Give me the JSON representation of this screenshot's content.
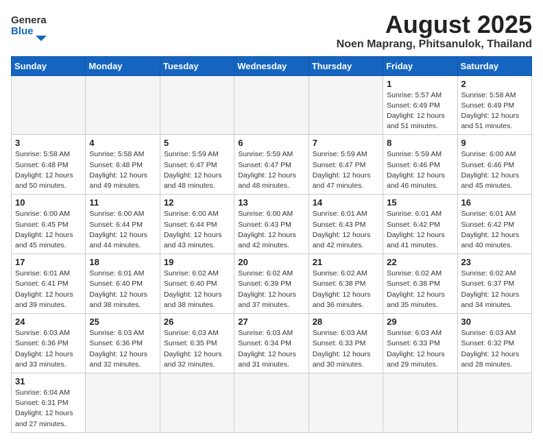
{
  "header": {
    "logo_general": "General",
    "logo_blue": "Blue",
    "month_title": "August 2025",
    "location": "Noen Maprang, Phitsanulok, Thailand"
  },
  "days_of_week": [
    "Sunday",
    "Monday",
    "Tuesday",
    "Wednesday",
    "Thursday",
    "Friday",
    "Saturday"
  ],
  "weeks": [
    [
      {
        "day": "",
        "info": ""
      },
      {
        "day": "",
        "info": ""
      },
      {
        "day": "",
        "info": ""
      },
      {
        "day": "",
        "info": ""
      },
      {
        "day": "",
        "info": ""
      },
      {
        "day": "1",
        "info": "Sunrise: 5:57 AM\nSunset: 6:49 PM\nDaylight: 12 hours\nand 51 minutes."
      },
      {
        "day": "2",
        "info": "Sunrise: 5:58 AM\nSunset: 6:49 PM\nDaylight: 12 hours\nand 51 minutes."
      }
    ],
    [
      {
        "day": "3",
        "info": "Sunrise: 5:58 AM\nSunset: 6:48 PM\nDaylight: 12 hours\nand 50 minutes."
      },
      {
        "day": "4",
        "info": "Sunrise: 5:58 AM\nSunset: 6:48 PM\nDaylight: 12 hours\nand 49 minutes."
      },
      {
        "day": "5",
        "info": "Sunrise: 5:59 AM\nSunset: 6:47 PM\nDaylight: 12 hours\nand 48 minutes."
      },
      {
        "day": "6",
        "info": "Sunrise: 5:59 AM\nSunset: 6:47 PM\nDaylight: 12 hours\nand 48 minutes."
      },
      {
        "day": "7",
        "info": "Sunrise: 5:59 AM\nSunset: 6:47 PM\nDaylight: 12 hours\nand 47 minutes."
      },
      {
        "day": "8",
        "info": "Sunrise: 5:59 AM\nSunset: 6:46 PM\nDaylight: 12 hours\nand 46 minutes."
      },
      {
        "day": "9",
        "info": "Sunrise: 6:00 AM\nSunset: 6:46 PM\nDaylight: 12 hours\nand 45 minutes."
      }
    ],
    [
      {
        "day": "10",
        "info": "Sunrise: 6:00 AM\nSunset: 6:45 PM\nDaylight: 12 hours\nand 45 minutes."
      },
      {
        "day": "11",
        "info": "Sunrise: 6:00 AM\nSunset: 6:44 PM\nDaylight: 12 hours\nand 44 minutes."
      },
      {
        "day": "12",
        "info": "Sunrise: 6:00 AM\nSunset: 6:44 PM\nDaylight: 12 hours\nand 43 minutes."
      },
      {
        "day": "13",
        "info": "Sunrise: 6:00 AM\nSunset: 6:43 PM\nDaylight: 12 hours\nand 42 minutes."
      },
      {
        "day": "14",
        "info": "Sunrise: 6:01 AM\nSunset: 6:43 PM\nDaylight: 12 hours\nand 42 minutes."
      },
      {
        "day": "15",
        "info": "Sunrise: 6:01 AM\nSunset: 6:42 PM\nDaylight: 12 hours\nand 41 minutes."
      },
      {
        "day": "16",
        "info": "Sunrise: 6:01 AM\nSunset: 6:42 PM\nDaylight: 12 hours\nand 40 minutes."
      }
    ],
    [
      {
        "day": "17",
        "info": "Sunrise: 6:01 AM\nSunset: 6:41 PM\nDaylight: 12 hours\nand 39 minutes."
      },
      {
        "day": "18",
        "info": "Sunrise: 6:01 AM\nSunset: 6:40 PM\nDaylight: 12 hours\nand 38 minutes."
      },
      {
        "day": "19",
        "info": "Sunrise: 6:02 AM\nSunset: 6:40 PM\nDaylight: 12 hours\nand 38 minutes."
      },
      {
        "day": "20",
        "info": "Sunrise: 6:02 AM\nSunset: 6:39 PM\nDaylight: 12 hours\nand 37 minutes."
      },
      {
        "day": "21",
        "info": "Sunrise: 6:02 AM\nSunset: 6:38 PM\nDaylight: 12 hours\nand 36 minutes."
      },
      {
        "day": "22",
        "info": "Sunrise: 6:02 AM\nSunset: 6:38 PM\nDaylight: 12 hours\nand 35 minutes."
      },
      {
        "day": "23",
        "info": "Sunrise: 6:02 AM\nSunset: 6:37 PM\nDaylight: 12 hours\nand 34 minutes."
      }
    ],
    [
      {
        "day": "24",
        "info": "Sunrise: 6:03 AM\nSunset: 6:36 PM\nDaylight: 12 hours\nand 33 minutes."
      },
      {
        "day": "25",
        "info": "Sunrise: 6:03 AM\nSunset: 6:36 PM\nDaylight: 12 hours\nand 32 minutes."
      },
      {
        "day": "26",
        "info": "Sunrise: 6:03 AM\nSunset: 6:35 PM\nDaylight: 12 hours\nand 32 minutes."
      },
      {
        "day": "27",
        "info": "Sunrise: 6:03 AM\nSunset: 6:34 PM\nDaylight: 12 hours\nand 31 minutes."
      },
      {
        "day": "28",
        "info": "Sunrise: 6:03 AM\nSunset: 6:33 PM\nDaylight: 12 hours\nand 30 minutes."
      },
      {
        "day": "29",
        "info": "Sunrise: 6:03 AM\nSunset: 6:33 PM\nDaylight: 12 hours\nand 29 minutes."
      },
      {
        "day": "30",
        "info": "Sunrise: 6:03 AM\nSunset: 6:32 PM\nDaylight: 12 hours\nand 28 minutes."
      }
    ],
    [
      {
        "day": "31",
        "info": "Sunrise: 6:04 AM\nSunset: 6:31 PM\nDaylight: 12 hours\nand 27 minutes."
      },
      {
        "day": "",
        "info": ""
      },
      {
        "day": "",
        "info": ""
      },
      {
        "day": "",
        "info": ""
      },
      {
        "day": "",
        "info": ""
      },
      {
        "day": "",
        "info": ""
      },
      {
        "day": "",
        "info": ""
      }
    ]
  ]
}
